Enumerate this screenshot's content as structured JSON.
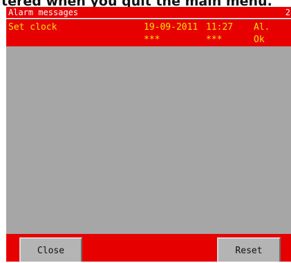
{
  "header_fragment": "tered when you quit the main menu.",
  "window": {
    "title": "Alarm messages",
    "page_number": "2"
  },
  "alarms": [
    {
      "message": "Set clock",
      "date": "19-09-2011",
      "time": "11:27",
      "status": "Al.",
      "ack_date": "***",
      "ack_time": "***",
      "ack_status": "Ok"
    }
  ],
  "buttons": {
    "close": "Close",
    "reset": "Reset"
  },
  "colors": {
    "panel_red": "#e60000",
    "text_yellow": "#ffe000",
    "list_gray": "#a6a6a6"
  }
}
